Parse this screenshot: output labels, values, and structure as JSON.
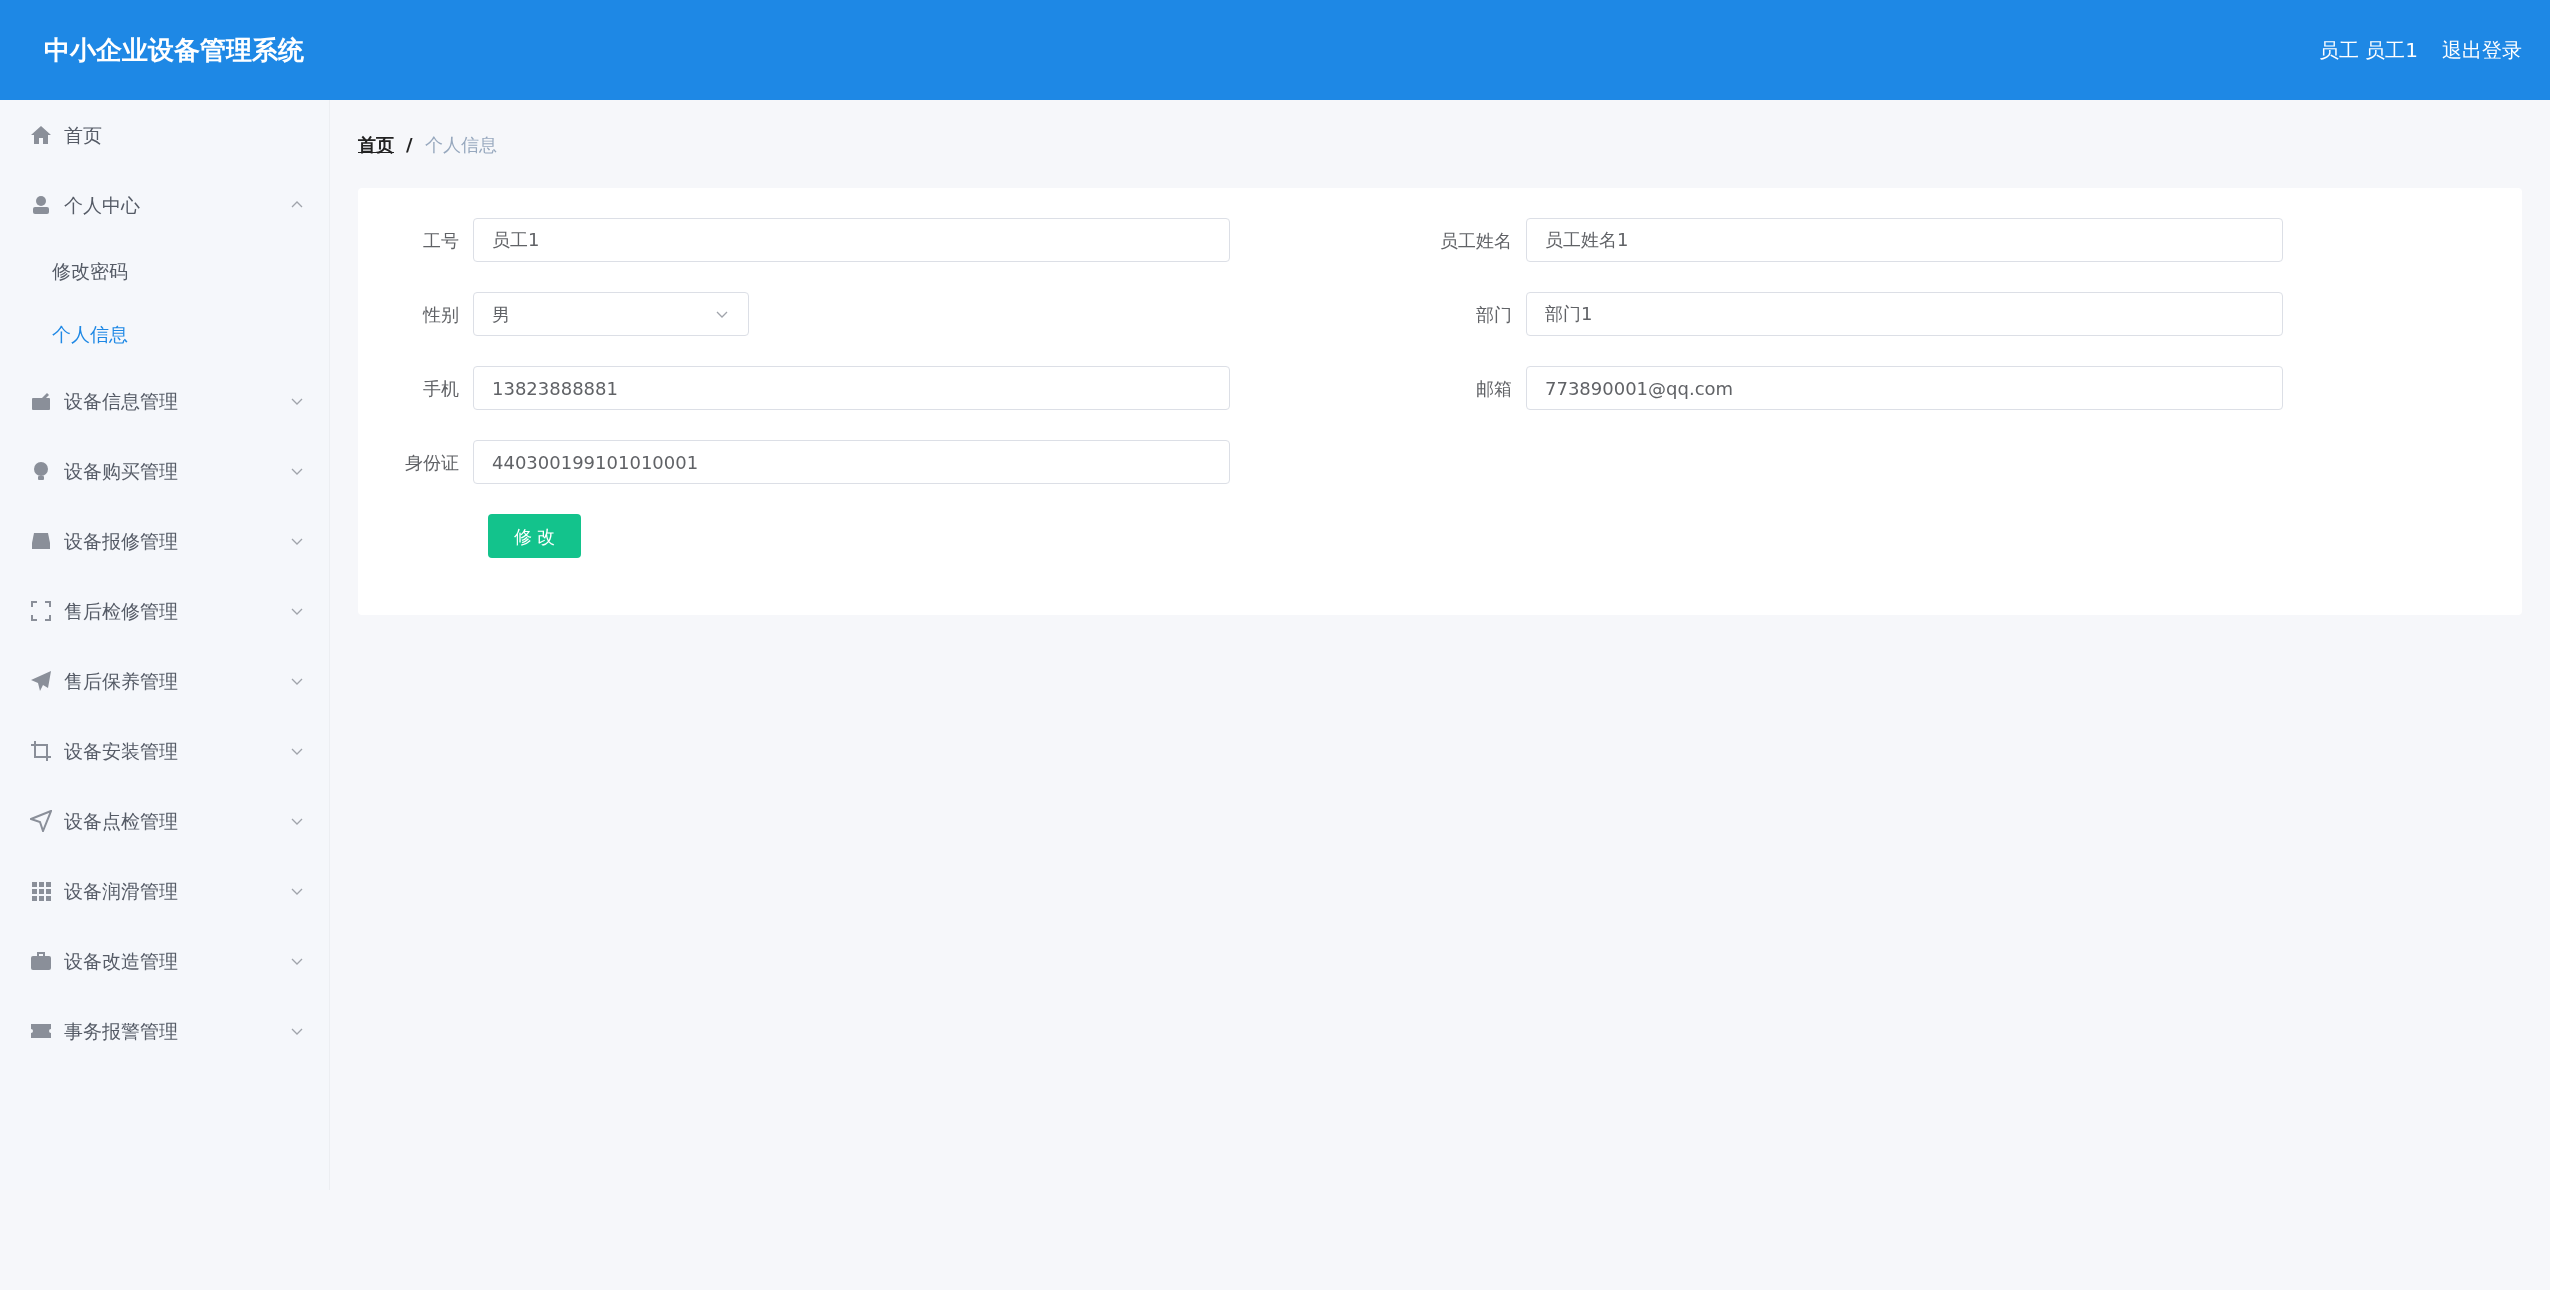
{
  "header": {
    "title": "中小企业设备管理系统",
    "user": "员工 员工1",
    "logout": "退出登录"
  },
  "sidebar": {
    "items": [
      {
        "label": "首页",
        "kind": "link"
      },
      {
        "label": "个人中心",
        "kind": "group",
        "expanded": true,
        "children": [
          {
            "label": "修改密码",
            "selected": false
          },
          {
            "label": "个人信息",
            "selected": true
          }
        ]
      },
      {
        "label": "设备信息管理",
        "kind": "group",
        "expanded": false
      },
      {
        "label": "设备购买管理",
        "kind": "group",
        "expanded": false
      },
      {
        "label": "设备报修管理",
        "kind": "group",
        "expanded": false
      },
      {
        "label": "售后检修管理",
        "kind": "group",
        "expanded": false
      },
      {
        "label": "售后保养管理",
        "kind": "group",
        "expanded": false
      },
      {
        "label": "设备安装管理",
        "kind": "group",
        "expanded": false
      },
      {
        "label": "设备点检管理",
        "kind": "group",
        "expanded": false
      },
      {
        "label": "设备润滑管理",
        "kind": "group",
        "expanded": false
      },
      {
        "label": "设备改造管理",
        "kind": "group",
        "expanded": false
      },
      {
        "label": "事务报警管理",
        "kind": "group",
        "expanded": false
      }
    ]
  },
  "breadcrumb": {
    "items": [
      "首页",
      "个人信息"
    ],
    "separator": "/"
  },
  "form": {
    "fields": [
      {
        "label": "工号",
        "kind": "text",
        "value": "员工1"
      },
      {
        "label": "员工姓名",
        "kind": "text",
        "value": "员工姓名1"
      },
      {
        "label": "性别",
        "kind": "select",
        "value": "男"
      },
      {
        "label": "部门",
        "kind": "text",
        "value": "部门1"
      },
      {
        "label": "手机",
        "kind": "text",
        "value": "13823888881"
      },
      {
        "label": "邮箱",
        "kind": "text",
        "value": "773890001@qq.com"
      },
      {
        "label": "身份证",
        "kind": "text",
        "value": "440300199101010001"
      }
    ],
    "submit": "修 改"
  }
}
